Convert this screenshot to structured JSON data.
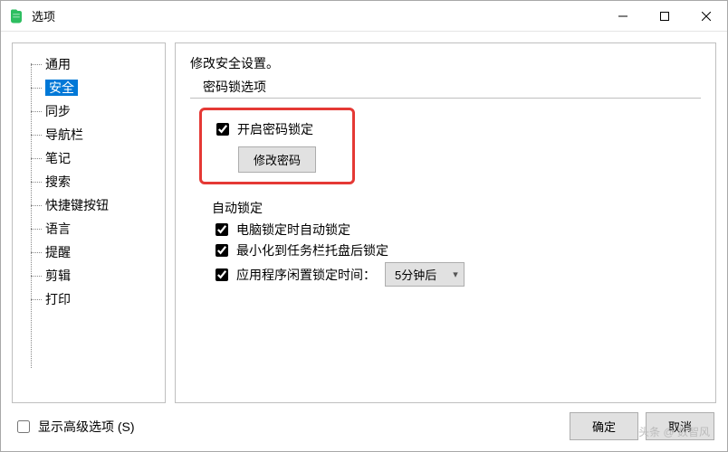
{
  "window": {
    "title": "选项"
  },
  "sidebar": {
    "items": [
      {
        "label": "通用"
      },
      {
        "label": "安全",
        "selected": true
      },
      {
        "label": "同步"
      },
      {
        "label": "导航栏"
      },
      {
        "label": "笔记"
      },
      {
        "label": "搜索"
      },
      {
        "label": "快捷键按钮"
      },
      {
        "label": "语言"
      },
      {
        "label": "提醒"
      },
      {
        "label": "剪辑"
      },
      {
        "label": "打印"
      }
    ]
  },
  "main": {
    "heading": "修改安全设置。",
    "group_label": "密码锁选项",
    "enable_lock": {
      "label": "开启密码锁定",
      "checked": true
    },
    "change_password_btn": "修改密码",
    "auto_lock_label": "自动锁定",
    "lock_on_pc_lock": {
      "label": "电脑锁定时自动锁定",
      "checked": true
    },
    "lock_on_minimize": {
      "label": "最小化到任务栏托盘后锁定",
      "checked": true
    },
    "lock_on_idle": {
      "label": "应用程序闲置锁定时间：",
      "checked": true
    },
    "idle_dropdown": {
      "value": "5分钟后"
    }
  },
  "footer": {
    "show_advanced": {
      "label": "显示高级选项 (S)",
      "checked": false
    },
    "ok": "确定",
    "cancel": "取消"
  },
  "watermark": "头条 @ 数智风"
}
